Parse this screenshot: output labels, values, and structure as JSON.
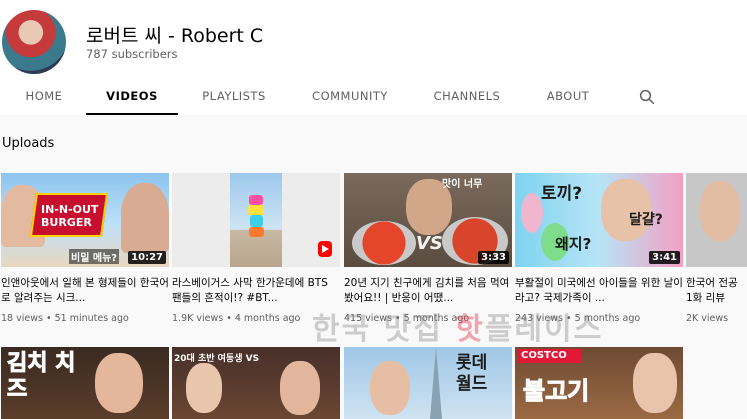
{
  "channel": {
    "name": "로버트 씨 - Robert C",
    "subscribers": "787 subscribers"
  },
  "tabs": [
    {
      "label": "HOME"
    },
    {
      "label": "VIDEOS"
    },
    {
      "label": "PLAYLISTS"
    },
    {
      "label": "COMMUNITY"
    },
    {
      "label": "CHANNELS"
    },
    {
      "label": "ABOUT"
    }
  ],
  "active_tab": "VIDEOS",
  "section": {
    "title": "Uploads"
  },
  "videos": [
    {
      "thumb_text": "IN-N-OUT BURGER",
      "thumb_subtext": "비밀 메뉴?",
      "duration": "10:27",
      "title": "인앤아웃에서 일해 본 형제들이 한국어로 알려주는 시크...",
      "views": "18 views",
      "age": "51 minutes ago"
    },
    {
      "thumb_text": "",
      "thumb_subtext": "",
      "duration": "",
      "title": "라스베이거스 사막 한가운데에 BTS 팬들의 흔적이!? #BT...",
      "views": "1.9K views",
      "age": "4 months ago"
    },
    {
      "thumb_text": "맛이 너무",
      "thumb_subtext": "VS",
      "duration": "3:33",
      "title": "20년 지기 친구에게 김치를 처음 먹여봤어요!! | 반응이 어땠...",
      "views": "415 views",
      "age": "5 months ago"
    },
    {
      "thumb_text": "토끼?",
      "thumb_subtext": "달걀?",
      "thumb_subtext2": "왜지?",
      "duration": "3:41",
      "title": "부활절이 미국에선 아이들을 위한 날이라고? 국제가족이 ...",
      "views": "243 views",
      "age": "5 months ago"
    },
    {
      "thumb_text": "",
      "thumb_subtext": "",
      "duration": "",
      "title": "한국어 전공 1화 리뷰",
      "views": "2K views",
      "age": ""
    },
    {
      "thumb_text": "김치 치즈",
      "thumb_subtext": "",
      "duration": "",
      "title": "",
      "views": "",
      "age": ""
    },
    {
      "thumb_text": "20대 초반 여동생 VS",
      "thumb_subtext": "",
      "duration": "",
      "title": "",
      "views": "",
      "age": ""
    },
    {
      "thumb_text": "롯데 월드",
      "thumb_subtext": "",
      "duration": "",
      "title": "",
      "views": "",
      "age": ""
    },
    {
      "thumb_text": "COSTCO",
      "thumb_subtext": "불고기",
      "duration": "",
      "title": "",
      "views": "",
      "age": ""
    }
  ],
  "watermark": {
    "text1": "한국 맛집 ",
    "text2": "핫",
    "text3": "플레이스"
  },
  "colors": {
    "accent": "#030303",
    "muted": "#606060",
    "shorts": "#ff0000",
    "background": "#f9f9f9"
  }
}
